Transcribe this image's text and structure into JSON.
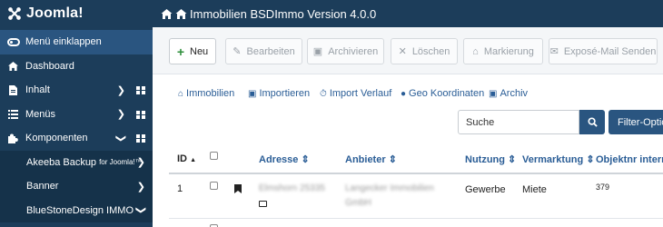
{
  "brand": {
    "name": "Joomla!"
  },
  "page_title": "Immobilien BSDImmo Version 4.0.0",
  "sidebar": {
    "collapse_label": "Menü einklappen",
    "items": [
      {
        "label": "Dashboard"
      },
      {
        "label": "Inhalt"
      },
      {
        "label": "Menüs"
      },
      {
        "label": "Komponenten"
      }
    ],
    "subitems": [
      {
        "label": "Akeeba Backup",
        "suffix": "for Joomla!™"
      },
      {
        "label": "Banner"
      },
      {
        "label": "BlueStoneDesign IMMO"
      }
    ]
  },
  "toolbar": {
    "new": "Neu",
    "edit": "Bearbeiten",
    "archive": "Archivieren",
    "delete": "Löschen",
    "mark": "Markierung",
    "expose_mail": "Exposé-Mail Senden"
  },
  "links": {
    "immobilien": "Immobilien",
    "importieren": "Importieren",
    "import_verlauf": "Import Verlauf",
    "geo": "Geo Koordinaten",
    "archiv": "Archiv"
  },
  "search": {
    "placeholder": "Suche",
    "filter_label": "Filter-Optionen"
  },
  "table": {
    "headers": {
      "id": "ID",
      "adresse": "Adresse",
      "anbieter": "Anbieter",
      "nutzung": "Nutzung",
      "vermarktung": "Vermarktung",
      "objektnr": "Objektnr intern"
    },
    "rows": [
      {
        "id": "1",
        "adresse": "Elmshorn 25335",
        "anbieter_line1": "Langecker Immobilien",
        "anbieter_line2": "GmbH",
        "nutzung": "Gewerbe",
        "vermarktung": "Miete",
        "objektnr": "379"
      }
    ]
  },
  "colors": {
    "sidebar": "#1c3d5a",
    "accent": "#2a5580",
    "link": "#2a5d96",
    "new_plus": "#2f8f3c"
  }
}
